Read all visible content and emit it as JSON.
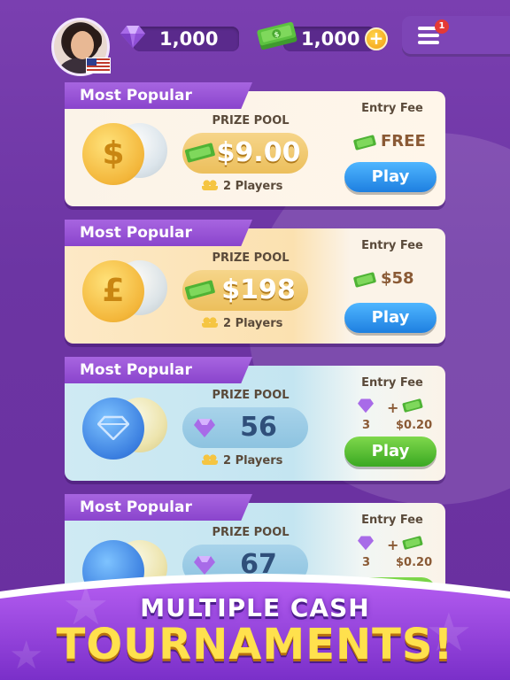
{
  "header": {
    "gems": "1,000",
    "cash": "1,000",
    "plus_symbol": "+",
    "notification_count": "1"
  },
  "cards": [
    {
      "tag": "Most Popular",
      "prize_label": "PRIZE POOL",
      "prize": "$9.00",
      "players": "2 Players",
      "entry_label": "Entry Fee",
      "entry_value": "FREE",
      "play": "Play",
      "coin_symbol": "$"
    },
    {
      "tag": "Most Popular",
      "prize_label": "PRIZE POOL",
      "prize": "$198",
      "players": "2 Players",
      "entry_label": "Entry Fee",
      "entry_value": "$58",
      "play": "Play",
      "coin_symbol": "£"
    },
    {
      "tag": "Most Popular",
      "prize_label": "PRIZE POOL",
      "prize": "56",
      "players": "2 Players",
      "entry_label": "Entry Fee",
      "gems_fee": "3",
      "plus": "+",
      "cash_fee": "$0.20",
      "play": "Play"
    },
    {
      "tag": "Most Popular",
      "prize_label": "PRIZE POOL",
      "prize": "67",
      "entry_label": "Entry Fee",
      "gems_fee": "3",
      "plus": "+",
      "cash_fee": "$0.20"
    }
  ],
  "banner": {
    "line1": "MULTIPLE CASH",
    "line2": "TOURNAMENTS!"
  },
  "colors": {
    "background": "#6c35a3",
    "tag": "#9a55d8",
    "gold": "#f5c542",
    "play_blue": "#1e7fe0",
    "play_green": "#3aa822"
  }
}
